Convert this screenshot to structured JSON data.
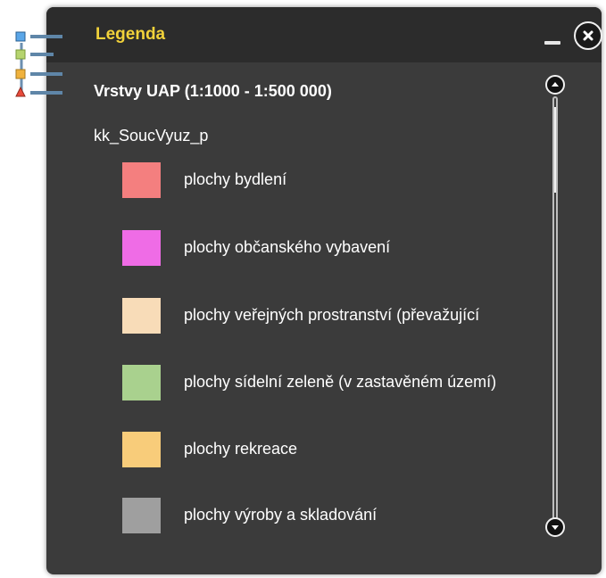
{
  "header": {
    "title": "Legenda"
  },
  "layer_group": {
    "title": "Vrstvy UAP  (1:1000 - 1:500 000)"
  },
  "layer": {
    "name": "kk_SoucVyuz_p"
  },
  "legend_items": [
    {
      "label": "plochy bydlení",
      "color": "#f47f7f"
    },
    {
      "label": "plochy občanského vybavení",
      "color": "#ef6ce6"
    },
    {
      "label": "plochy veřejných prostranství (převažující",
      "color": "#f8dcb8"
    },
    {
      "label": "plochy sídelní zeleně (v zastavěném území)",
      "color": "#a9d18e"
    },
    {
      "label": "plochy rekreace",
      "color": "#f8cc7a"
    },
    {
      "label": "plochy výroby a skladování",
      "color": "#9f9f9f"
    }
  ],
  "icons": {
    "legend": "legend-list-icon",
    "minimize": "minimize-icon",
    "close": "close-icon",
    "scroll_up": "scroll-up-icon",
    "scroll_down": "scroll-down-icon"
  }
}
